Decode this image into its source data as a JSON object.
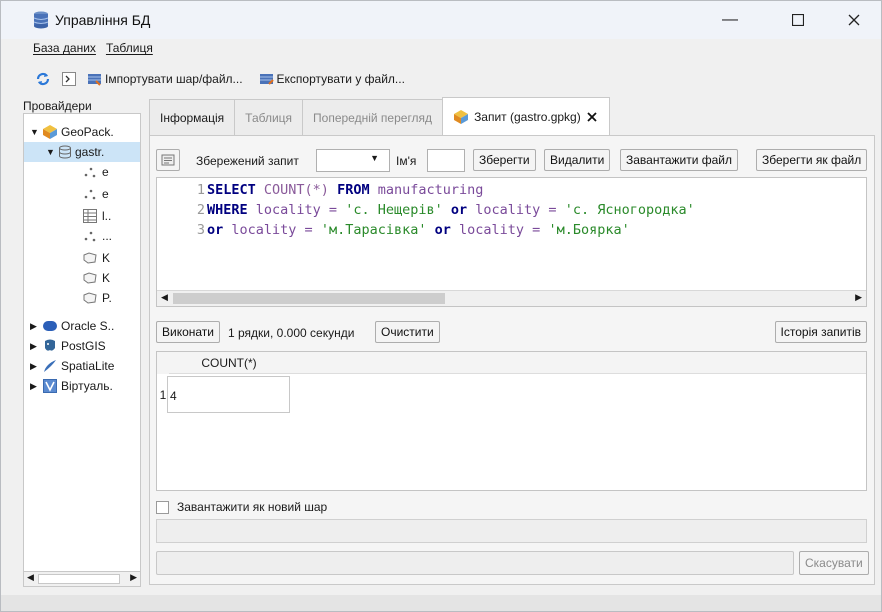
{
  "window": {
    "title": "Управління БД"
  },
  "menu": {
    "items": [
      "База даних",
      "Таблиця"
    ]
  },
  "toolbar": {
    "import_label": "Імпортувати шар/файл...",
    "export_label": "Експортувати у файл..."
  },
  "providers": {
    "label": "Провайдери",
    "items": [
      {
        "label": "GeoPack."
      },
      {
        "label": "gastr."
      },
      {
        "label": "e"
      },
      {
        "label": "e"
      },
      {
        "label": "l.."
      },
      {
        "label": "..."
      },
      {
        "label": "K"
      },
      {
        "label": "K"
      },
      {
        "label": "P."
      },
      {
        "label": "Oracle S.."
      },
      {
        "label": "PostGIS"
      },
      {
        "label": "SpatiaLite"
      },
      {
        "label": "Віртуаль."
      }
    ]
  },
  "tabs": [
    {
      "label": "Інформація"
    },
    {
      "label": "Таблиця"
    },
    {
      "label": "Попередній перегляд"
    },
    {
      "label": "Запит (gastro.gpkg)"
    }
  ],
  "query_bar": {
    "saved_query_label": "Збережений запит",
    "name_label": "Ім'я",
    "save_label": "Зберегти",
    "delete_label": "Видалити",
    "load_file_label": "Завантажити файл",
    "save_as_file_label": "Зберегти як файл"
  },
  "editor": {
    "lines": [
      {
        "num": "1",
        "tokens": [
          {
            "t": "SELECT ",
            "c": "kw"
          },
          {
            "t": "COUNT",
            "c": "fn"
          },
          {
            "t": "(*)",
            "c": "fn"
          },
          {
            "t": " ",
            "c": ""
          },
          {
            "t": "FROM",
            "c": "kw"
          },
          {
            "t": " manufacturing",
            "c": "id"
          }
        ]
      },
      {
        "num": "2",
        "tokens": [
          {
            "t": "WHERE",
            "c": "kw"
          },
          {
            "t": " locality = ",
            "c": "id"
          },
          {
            "t": "'с. Нещерів'",
            "c": "str"
          },
          {
            "t": " ",
            "c": ""
          },
          {
            "t": "or",
            "c": "kw"
          },
          {
            "t": " locality = ",
            "c": "id"
          },
          {
            "t": "'с. Ясногородка'",
            "c": "str"
          }
        ]
      },
      {
        "num": "3",
        "tokens": [
          {
            "t": "or",
            "c": "kw"
          },
          {
            "t": " locality = ",
            "c": "id"
          },
          {
            "t": "'м.Тарасівка'",
            "c": "str"
          },
          {
            "t": " ",
            "c": ""
          },
          {
            "t": "or",
            "c": "kw"
          },
          {
            "t": " locality = ",
            "c": "id"
          },
          {
            "t": "'м.Боярка'",
            "c": "str"
          }
        ]
      }
    ]
  },
  "exec_bar": {
    "execute_label": "Виконати",
    "status": "1 рядки, 0.000 секунди",
    "clear_label": "Очистити",
    "history_label": "Історія запитів"
  },
  "results": {
    "columns": [
      "COUNT(*)"
    ],
    "rows": [
      {
        "num": "1",
        "cells": [
          "4"
        ]
      }
    ]
  },
  "load_as_layer_label": "Завантажити як новий шар",
  "cancel_label": "Скасувати",
  "colors": {
    "accent": "#2b78d8",
    "keyword": "#000080",
    "string": "#2a8a2a"
  }
}
